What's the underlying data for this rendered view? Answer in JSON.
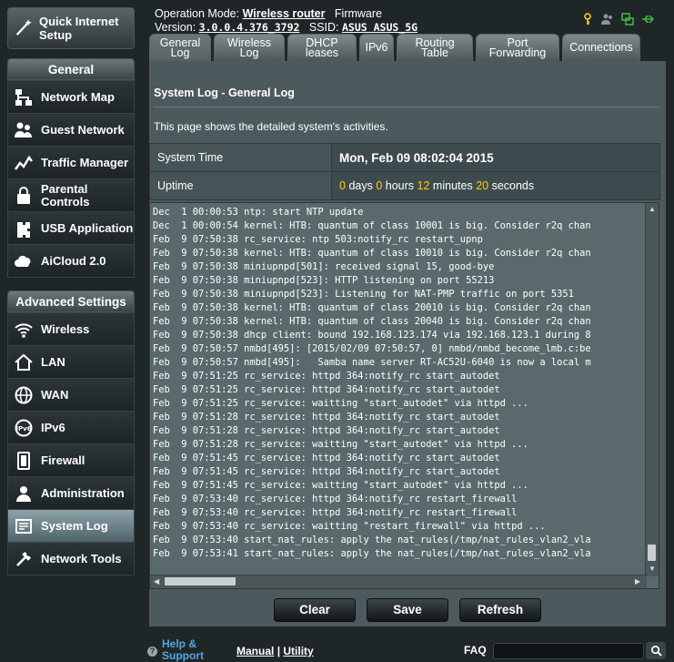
{
  "sidebar": {
    "quick_setup": "Quick Internet Setup",
    "general_title": "General",
    "general_items": [
      {
        "label": "Network Map",
        "icon": "network-map-icon"
      },
      {
        "label": "Guest Network",
        "icon": "guest-network-icon"
      },
      {
        "label": "Traffic Manager",
        "icon": "traffic-manager-icon"
      },
      {
        "label": "Parental Controls",
        "icon": "parental-controls-icon"
      },
      {
        "label": "USB Application",
        "icon": "usb-icon"
      },
      {
        "label": "AiCloud 2.0",
        "icon": "cloud-icon"
      }
    ],
    "advanced_title": "Advanced Settings",
    "advanced_items": [
      {
        "label": "Wireless",
        "icon": "wireless-icon"
      },
      {
        "label": "LAN",
        "icon": "home-icon"
      },
      {
        "label": "WAN",
        "icon": "globe-icon"
      },
      {
        "label": "IPv6",
        "icon": "ipv6-icon"
      },
      {
        "label": "Firewall",
        "icon": "firewall-icon"
      },
      {
        "label": "Administration",
        "icon": "administration-icon"
      },
      {
        "label": "System Log",
        "icon": "system-log-icon",
        "active": true
      },
      {
        "label": "Network Tools",
        "icon": "tools-icon"
      }
    ]
  },
  "header": {
    "op_mode_label": "Operation Mode:",
    "op_mode_value": "Wireless router",
    "firmware_label": "Firmware",
    "version_label": "Version:",
    "version_value": "3.0.0.4.376_3792",
    "ssid_label": "SSID:",
    "ssid_value": "ASUS ASUS_5G"
  },
  "tabs": [
    {
      "label": "General Log",
      "active": true
    },
    {
      "label": "Wireless Log"
    },
    {
      "label": "DHCP leases"
    },
    {
      "label": "IPv6"
    },
    {
      "label": "Routing Table"
    },
    {
      "label": "Port Forwarding"
    },
    {
      "label": "Connections"
    }
  ],
  "page": {
    "title": "System Log - General Log",
    "description": "This page shows the detailed system's activities.",
    "system_time_label": "System Time",
    "system_time_value": "Mon, Feb 09  08:02:04  2015",
    "uptime_label": "Uptime",
    "uptime": {
      "days": "0",
      "days_unit": "days",
      "hours": "0",
      "hours_unit": "hours",
      "minutes": "12",
      "minutes_unit": "minutes",
      "seconds": "20",
      "seconds_unit": "seconds"
    }
  },
  "log_lines": [
    "Dec  1 00:00:53 ntp: start NTP update",
    "Dec  1 00:00:54 kernel: HTB: quantum of class 10001 is big. Consider r2q chan",
    "Feb  9 07:50:38 rc_service: ntp 503:notify_rc restart_upnp",
    "Feb  9 07:50:38 kernel: HTB: quantum of class 10010 is big. Consider r2q chan",
    "Feb  9 07:50:38 miniupnpd[501]: received signal 15, good-bye",
    "Feb  9 07:50:38 miniupnpd[523]: HTTP listening on port 55213",
    "Feb  9 07:50:38 miniupnpd[523]: Listening for NAT-PMP traffic on port 5351",
    "Feb  9 07:50:38 kernel: HTB: quantum of class 20010 is big. Consider r2q chan",
    "Feb  9 07:50:38 kernel: HTB: quantum of class 20040 is big. Consider r2q chan",
    "Feb  9 07:50:38 dhcp client: bound 192.168.123.174 via 192.168.123.1 during 8",
    "Feb  9 07:50:57 nmbd[495]: [2015/02/09 07:50:57, 0] nmbd/nmbd_become_lmb.c:be",
    "Feb  9 07:50:57 nmbd[495]:   Samba name server RT-AC52U-6040 is now a local m",
    "Feb  9 07:51:25 rc_service: httpd 364:notify_rc start_autodet",
    "Feb  9 07:51:25 rc_service: httpd 364:notify_rc start_autodet",
    "Feb  9 07:51:25 rc_service: waitting \"start_autodet\" via httpd ...",
    "Feb  9 07:51:28 rc_service: httpd 364:notify_rc start_autodet",
    "Feb  9 07:51:28 rc_service: httpd 364:notify_rc start_autodet",
    "Feb  9 07:51:28 rc_service: waitting \"start_autodet\" via httpd ...",
    "Feb  9 07:51:45 rc_service: httpd 364:notify_rc start_autodet",
    "Feb  9 07:51:45 rc_service: httpd 364:notify_rc start_autodet",
    "Feb  9 07:51:45 rc_service: waitting \"start_autodet\" via httpd ...",
    "Feb  9 07:53:40 rc_service: httpd 364:notify_rc restart_firewall",
    "Feb  9 07:53:40 rc_service: httpd 364:notify_rc restart_firewall",
    "Feb  9 07:53:40 rc_service: waitting \"restart_firewall\" via httpd ...",
    "Feb  9 07:53:40 start_nat_rules: apply the nat_rules(/tmp/nat_rules_vlan2_vla",
    "Feb  9 07:53:41 start_nat_rules: apply the nat_rules(/tmp/nat_rules_vlan2_vla"
  ],
  "buttons": {
    "clear": "Clear",
    "save": "Save",
    "refresh": "Refresh"
  },
  "footer": {
    "help": "Help & Support",
    "manual": "Manual",
    "separator": "|",
    "utility": "Utility",
    "faq": "FAQ"
  },
  "colors": {
    "accent_yellow": "#ffcc00",
    "help_blue": "#57a6e3",
    "status_green": "#3fbf3f"
  }
}
